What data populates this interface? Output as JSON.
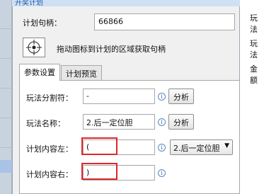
{
  "window": {
    "title": "开奖计划"
  },
  "handle": {
    "label": "计划句柄：",
    "value": "66866"
  },
  "grab": {
    "hint": "拖动图标到计划的区域获取句柄"
  },
  "tabs": [
    {
      "label": "参数设置",
      "active": true
    },
    {
      "label": "计划预览",
      "active": false
    }
  ],
  "params": {
    "separator_label": "玩法分割符：",
    "separator_value": "-",
    "name_label": "玩法名称：",
    "name_value": "2.后一定位胆",
    "content_left_label": "计划内容左：",
    "content_left_value": "(",
    "content_left_select": "2.后一定位胆",
    "content_right_label": "计划内容右：",
    "content_right_value": ")",
    "analyze_label": "分析",
    "info_glyph": "i"
  },
  "right_partial": [
    "玩法",
    "玩法",
    "金额"
  ],
  "colors": {
    "highlight": "#e0262b",
    "accent": "#1e5aa8"
  }
}
